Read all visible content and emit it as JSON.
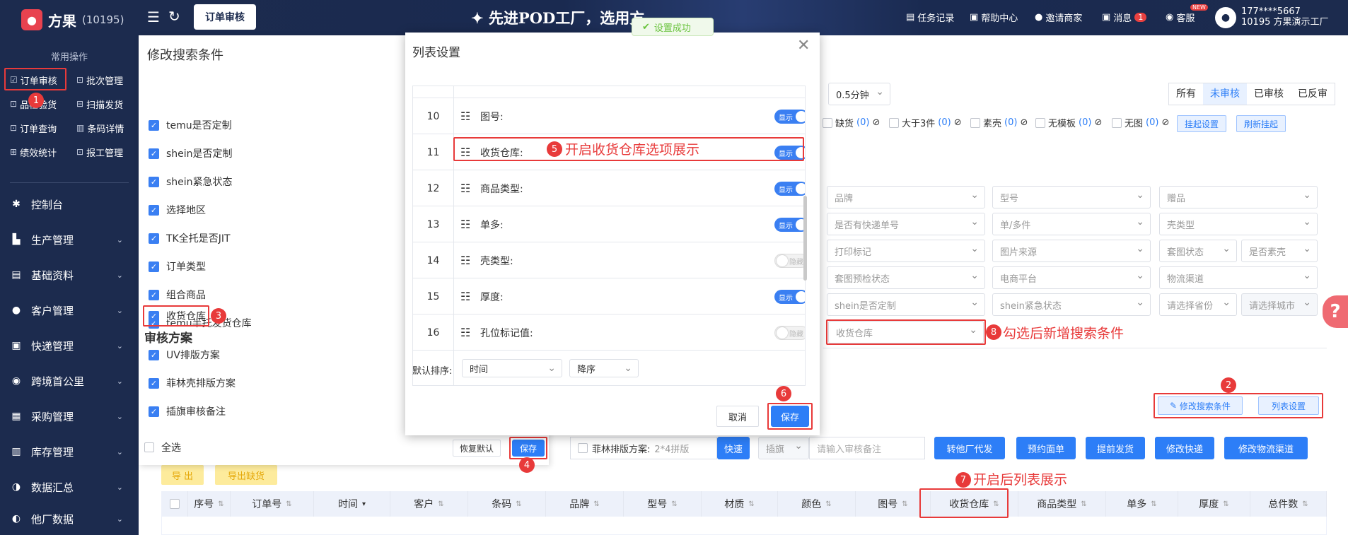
{
  "app": {
    "name": "方果",
    "tenant_id": "(10195)"
  },
  "sidebar": {
    "section_title": "常用操作",
    "quick_actions": [
      {
        "label": "订单审核",
        "icon": "☑"
      },
      {
        "label": "批次管理",
        "icon": "⊡"
      },
      {
        "label": "品检验货",
        "icon": "⊡"
      },
      {
        "label": "扫描发货",
        "icon": "⊟"
      },
      {
        "label": "订单查询",
        "icon": "⊡"
      },
      {
        "label": "条码详情",
        "icon": "▥"
      },
      {
        "label": "绩效统计",
        "icon": "⊞"
      },
      {
        "label": "报工管理",
        "icon": "⊡"
      }
    ],
    "menu": [
      {
        "label": "控制台",
        "icon": "✱"
      },
      {
        "label": "生产管理",
        "icon": "▙"
      },
      {
        "label": "基础资料",
        "icon": "▤"
      },
      {
        "label": "客户管理",
        "icon": "●"
      },
      {
        "label": "快递管理",
        "icon": "▣"
      },
      {
        "label": "跨境首公里",
        "icon": "◉"
      },
      {
        "label": "采购管理",
        "icon": "▦"
      },
      {
        "label": "库存管理",
        "icon": "▥"
      },
      {
        "label": "数据汇总",
        "icon": "◑"
      },
      {
        "label": "他厂数据",
        "icon": "◐"
      }
    ]
  },
  "topbar": {
    "active_tab": "订单审核",
    "banner": "先进POD工厂，选用方",
    "links": [
      {
        "label": "任务记录"
      },
      {
        "label": "帮助中心"
      },
      {
        "label": "邀请商家"
      },
      {
        "label": "消息",
        "badge": "1"
      },
      {
        "label": "客服",
        "badge": "NEW"
      }
    ],
    "user_phone": "177****5667",
    "user_company": "10195  方果演示工厂"
  },
  "toast": "设置成功",
  "filters": {
    "interval": "0.5分钟",
    "status_tabs": [
      "所有",
      "未审核",
      "已审核",
      "已反审"
    ],
    "active_status": "未审核",
    "flags": [
      {
        "label": "缺货",
        "count": "(0)"
      },
      {
        "label": "大于3件",
        "count": "(0)"
      },
      {
        "label": "素壳",
        "count": "(0)"
      },
      {
        "label": "无模板",
        "count": "(0)"
      },
      {
        "label": "无图",
        "count": "(0)"
      }
    ],
    "btn_suspend_settings": "挂起设置",
    "btn_refresh_suspend": "刷新挂起",
    "selects": {
      "brand": "品牌",
      "model": "型号",
      "gift": "赠品",
      "has_express": "是否有快递单号",
      "single_multi": "单/多件",
      "shell_type": "壳类型",
      "print_mark": "打印标记",
      "image_source": "图片来源",
      "cover_status": "套图状态",
      "plain_shell": "是否素壳",
      "cover_check": "套图预检状态",
      "platform": "电商平台",
      "logistics": "物流渠道",
      "shein_custom": "shein是否定制",
      "shein_urgent": "shein紧急状态",
      "province": "请选择省份",
      "city": "请选择城市",
      "warehouse": "收货仓库"
    },
    "btn_edit_search": "修改搜索条件",
    "btn_list_settings": "列表设置"
  },
  "actions": {
    "feilin_label": "菲林排版方案:",
    "feilin_value": "2*4拼版",
    "fast": "快速",
    "flag_select": "插旗",
    "remark_placeholder": "请输入审核备注",
    "buttons": [
      "转他厂代发",
      "预约面单",
      "提前发货",
      "修改快递",
      "修改物流渠道"
    ],
    "export": "导 出",
    "export_missing": "导出缺货"
  },
  "table": {
    "columns": [
      "序号",
      "订单号",
      "时间",
      "客户",
      "条码",
      "品牌",
      "型号",
      "材质",
      "颜色",
      "图号",
      "收货仓库",
      "商品类型",
      "单多",
      "厚度",
      "总件数"
    ]
  },
  "left_panel": {
    "title": "修改搜索条件",
    "items": [
      "temu是否定制",
      "shein是否定制",
      "shein紧急状态",
      "选择地区",
      "TK全托是否JIT",
      "订单类型",
      "组合商品",
      "temu半托发货仓库",
      "收货仓库"
    ],
    "group": "审核方案",
    "group_items": [
      "UV排版方案",
      "菲林壳排版方案",
      "插旗审核备注"
    ],
    "select_all": "全选",
    "restore": "恢复默认",
    "save": "保存"
  },
  "modal": {
    "title": "列表设置",
    "rows": [
      {
        "no": "10",
        "label": "图号:",
        "state": "显示",
        "on": true
      },
      {
        "no": "11",
        "label": "收货仓库:",
        "state": "显示",
        "on": true
      },
      {
        "no": "12",
        "label": "商品类型:",
        "state": "显示",
        "on": true
      },
      {
        "no": "13",
        "label": "单多:",
        "state": "显示",
        "on": true
      },
      {
        "no": "14",
        "label": "壳类型:",
        "state": "隐藏",
        "on": false
      },
      {
        "no": "15",
        "label": "厚度:",
        "state": "显示",
        "on": true
      },
      {
        "no": "16",
        "label": "孔位标记值:",
        "state": "隐藏",
        "on": false
      }
    ],
    "sort_label": "默认排序:",
    "sort_field": "时间",
    "sort_order": "降序",
    "cancel": "取消",
    "save": "保存"
  },
  "annotations": {
    "a5": "开启收货仓库选项展示",
    "a7": "开启后列表展示",
    "a8": "勾选后新增搜索条件"
  },
  "colors": {
    "sidebar": "#1c2b4e",
    "accent": "#2d7ef7",
    "annotation": "#e83a3a"
  }
}
